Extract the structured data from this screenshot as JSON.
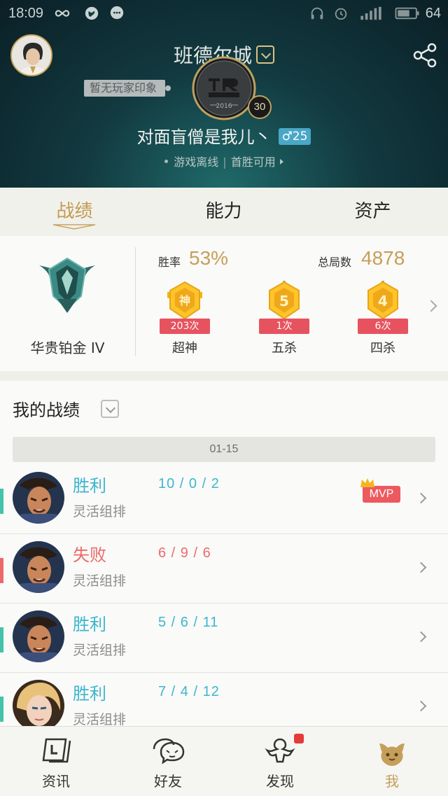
{
  "statusbar": {
    "time": "18:09",
    "battery": "64"
  },
  "profile": {
    "server": "班德尔城",
    "impression": "暂无玩家印象",
    "level": "30",
    "nickname": "对面盲僧是我儿丶",
    "gender_age": "♂25",
    "status": "游戏离线",
    "first_win": "首胜可用",
    "emblem_year": "2016"
  },
  "tabs": [
    "战绩",
    "能力",
    "资产"
  ],
  "rank": {
    "tier": "华贵铂金 IV",
    "winrate_label": "胜率",
    "winrate": "53%",
    "total_label": "总局数",
    "total": "4878",
    "badges": [
      {
        "glyph": "神",
        "count": "203次",
        "label": "超神"
      },
      {
        "glyph": "5",
        "count": "1次",
        "label": "五杀"
      },
      {
        "glyph": "4",
        "count": "6次",
        "label": "四杀"
      }
    ]
  },
  "records": {
    "title": "我的战绩",
    "date": "01-15",
    "matches": [
      {
        "result": "胜利",
        "kda": "10 / 0 / 2",
        "mode": "灵活组排",
        "mvp": "MVP",
        "outcome": "win",
        "hero": "garen"
      },
      {
        "result": "失败",
        "kda": "6 / 9 / 6",
        "mode": "灵活组排",
        "outcome": "loss",
        "hero": "garen"
      },
      {
        "result": "胜利",
        "kda": "5 / 6 / 11",
        "mode": "灵活组排",
        "outcome": "win",
        "hero": "garen"
      },
      {
        "result": "胜利",
        "kda": "7 / 4 / 12",
        "mode": "灵活组排",
        "outcome": "win",
        "hero": "lux"
      }
    ]
  },
  "nav": [
    "资讯",
    "好友",
    "发现",
    "我"
  ],
  "colors": {
    "gold": "#c59f5a",
    "win": "#3cb6cf",
    "loss": "#ec6a6a",
    "win_marker": "#44c3a9"
  }
}
